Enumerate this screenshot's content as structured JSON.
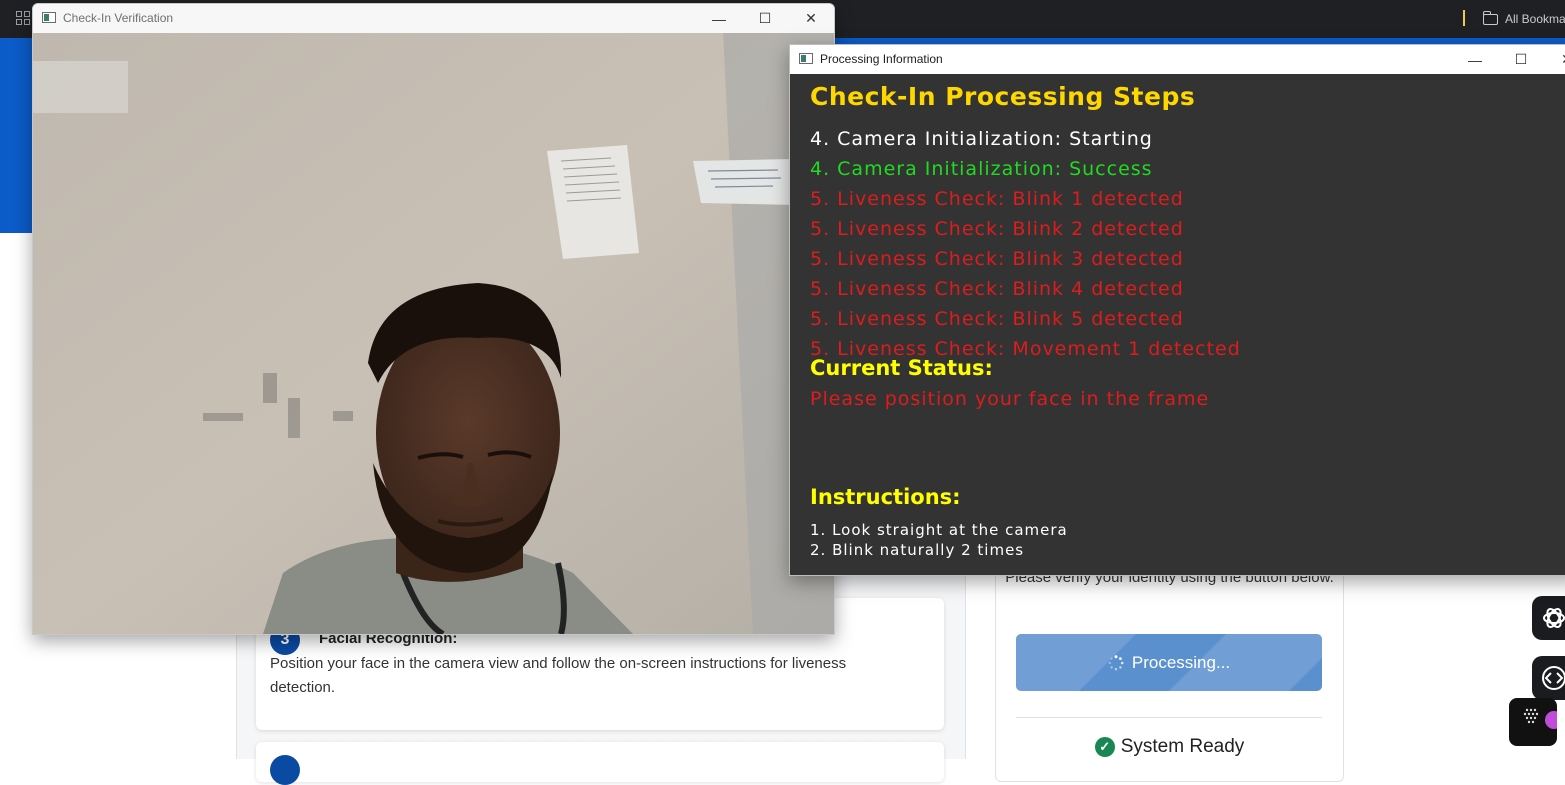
{
  "browser": {
    "bookmarks_label": "All Bookma"
  },
  "page": {
    "step3": {
      "number": "3",
      "title": "Facial Recognition:",
      "description": "Position your face in the camera view and follow the on-screen instructions for liveness detection."
    },
    "verify_text": "Please verify your identity using the button below.",
    "processing_button_label": "Processing...",
    "system_status": "System Ready"
  },
  "checkin_window": {
    "title": "Check-In Verification",
    "controls": [
      "—",
      "☐",
      "✕"
    ]
  },
  "processing_window": {
    "title": "Processing Information",
    "controls": [
      "—",
      "☐",
      "✕"
    ],
    "heading": "Check-In Processing Steps",
    "steps": [
      {
        "text": "4. Camera Initialization: Starting",
        "color": "#ffffff"
      },
      {
        "text": "4. Camera Initialization: Success",
        "color": "#1fdc1f"
      },
      {
        "text": "5. Liveness Check: Blink 1 detected",
        "color": "#dd1c1c"
      },
      {
        "text": "5. Liveness Check: Blink 2 detected",
        "color": "#dd1c1c"
      },
      {
        "text": "5. Liveness Check: Blink 3 detected",
        "color": "#dd1c1c"
      },
      {
        "text": "5. Liveness Check: Blink 4 detected",
        "color": "#dd1c1c"
      },
      {
        "text": "5. Liveness Check: Blink 5 detected",
        "color": "#dd1c1c"
      },
      {
        "text": "5. Liveness Check: Movement 1 detected",
        "color": "#dd1c1c"
      }
    ],
    "status_heading": "Current Status:",
    "status_text": "Please position your face in the frame",
    "instructions_heading": "Instructions:",
    "instructions": [
      "1. Look straight at the camera",
      "2. Blink naturally 2 times"
    ]
  },
  "colors": {
    "heading": "#ffd700",
    "label_yellow": "#ffff00",
    "success": "#1fdc1f",
    "error": "#dd1c1c",
    "brand_blue": "#0b5bc9"
  }
}
